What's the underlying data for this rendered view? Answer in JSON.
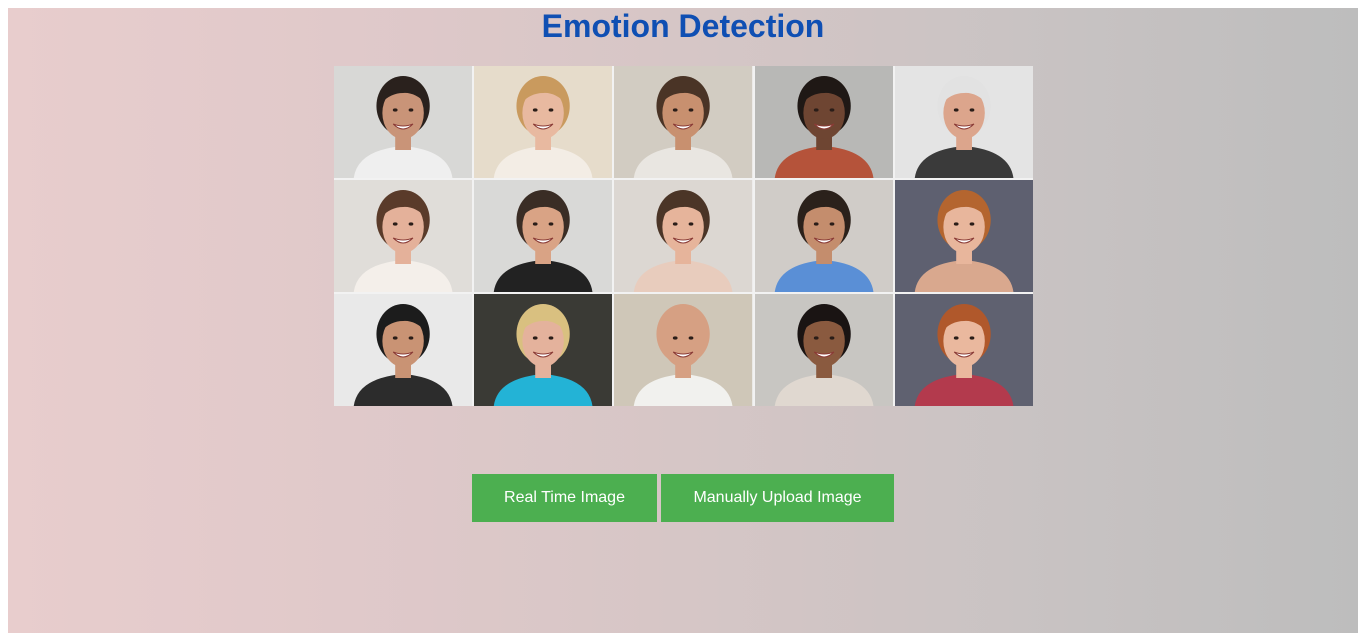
{
  "header": {
    "title": "Emotion Detection"
  },
  "collage": {
    "image_name": "smiling-faces-collage-image",
    "faces": [
      {
        "name": "face-man-dark-hair",
        "bg": "#d8d8d6",
        "skin": "#c99478",
        "hair": "#2a211d",
        "shirt": "#efefef"
      },
      {
        "name": "face-woman-blonde",
        "bg": "#e6dccb",
        "skin": "#e8b9a0",
        "hair": "#c99a5e",
        "shirt": "#f3ede5"
      },
      {
        "name": "face-man-curly-beard",
        "bg": "#d2ccc2",
        "skin": "#c8906f",
        "hair": "#4a3426",
        "shirt": "#e9e6e1"
      },
      {
        "name": "face-woman-short-hair",
        "bg": "#b8b8b6",
        "skin": "#6e4532",
        "hair": "#1f1815",
        "shirt": "#b5533a"
      },
      {
        "name": "face-elderly-man-glasses",
        "bg": "#e4e4e4",
        "skin": "#dca58c",
        "hair": "#e2e2e2",
        "shirt": "#3a3a3a"
      },
      {
        "name": "face-woman-brown-hair",
        "bg": "#e0ddd9",
        "skin": "#e4b19a",
        "hair": "#5a3b2a",
        "shirt": "#f4efea"
      },
      {
        "name": "face-man-bowtie",
        "bg": "#d9d9d7",
        "skin": "#d9a385",
        "hair": "#3a2d25",
        "shirt": "#222222"
      },
      {
        "name": "face-woman-smiling",
        "bg": "#dcd7d2",
        "skin": "#e6b49b",
        "hair": "#4b3527",
        "shirt": "#e8ccbd"
      },
      {
        "name": "face-man-blue-shirt",
        "bg": "#d0ccc8",
        "skin": "#c48d6d",
        "hair": "#2b211b",
        "shirt": "#5a8fd6"
      },
      {
        "name": "face-woman-red-hair",
        "bg": "#5e6070",
        "skin": "#e8b69c",
        "hair": "#b4652f",
        "shirt": "#d9a88e"
      },
      {
        "name": "face-man-suit",
        "bg": "#e9e9e9",
        "skin": "#c99374",
        "hair": "#1c1c1c",
        "shirt": "#2c2c2c"
      },
      {
        "name": "face-woman-blonde-glasses",
        "bg": "#3a3a35",
        "skin": "#e4b29c",
        "hair": "#d9c080",
        "shirt": "#23b3d6"
      },
      {
        "name": "face-bald-man-glasses",
        "bg": "#cfc7b8",
        "skin": "#d6a083",
        "hair": "#d6a083",
        "shirt": "#f1f1ee"
      },
      {
        "name": "face-woman-long-black-hair",
        "bg": "#c8c6c2",
        "skin": "#8a5a3f",
        "hair": "#1a1413",
        "shirt": "#e0d8d0"
      },
      {
        "name": "face-boy-red-hair-glasses",
        "bg": "#5f6170",
        "skin": "#eab89e",
        "hair": "#b0582b",
        "shirt": "#b33a4d"
      }
    ]
  },
  "actions": {
    "realtime_label": "Real Time Image",
    "upload_label": "Manually Upload Image"
  },
  "colors": {
    "title": "#0f4fb3",
    "button": "#4caf50",
    "button_text": "#ffffff"
  }
}
